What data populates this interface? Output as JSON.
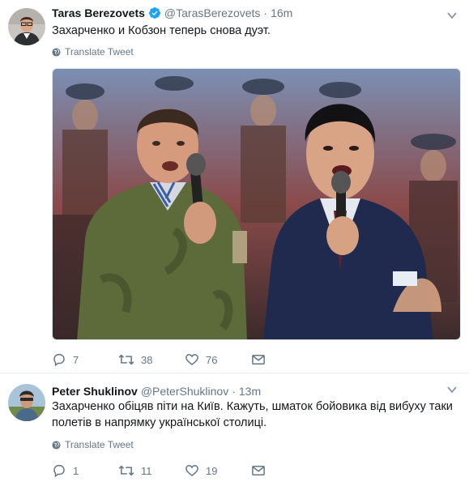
{
  "tweets": [
    {
      "name": "Taras Berezovets",
      "handle": "@TarasBerezovets",
      "time": "16m",
      "text": "Захарченко и Кобзон теперь снова дуэт.",
      "translate_label": "Translate Tweet",
      "verified": true,
      "has_media": true,
      "replies": "7",
      "retweets": "38",
      "likes": "76"
    },
    {
      "name": "Peter Shuklinov",
      "handle": "@PeterShuklinov",
      "time": "13m",
      "text": "Захарченко обіцяв піти на Київ. Кажуть, шматок бойовика від вибуху таки полетів в напрямку української столиці.",
      "translate_label": "Translate Tweet",
      "verified": false,
      "has_media": false,
      "replies": "1",
      "retweets": "11",
      "likes": "19"
    }
  ],
  "icons": {
    "verified": "verified-badge-icon",
    "caret": "chevron-down-icon",
    "globe": "globe-icon",
    "reply": "reply-icon",
    "retweet": "retweet-icon",
    "like": "heart-icon",
    "dm": "envelope-icon"
  },
  "colors": {
    "text": "#14171a",
    "secondary": "#657786",
    "verified": "#1da1f2",
    "border": "#e6ecf0"
  }
}
